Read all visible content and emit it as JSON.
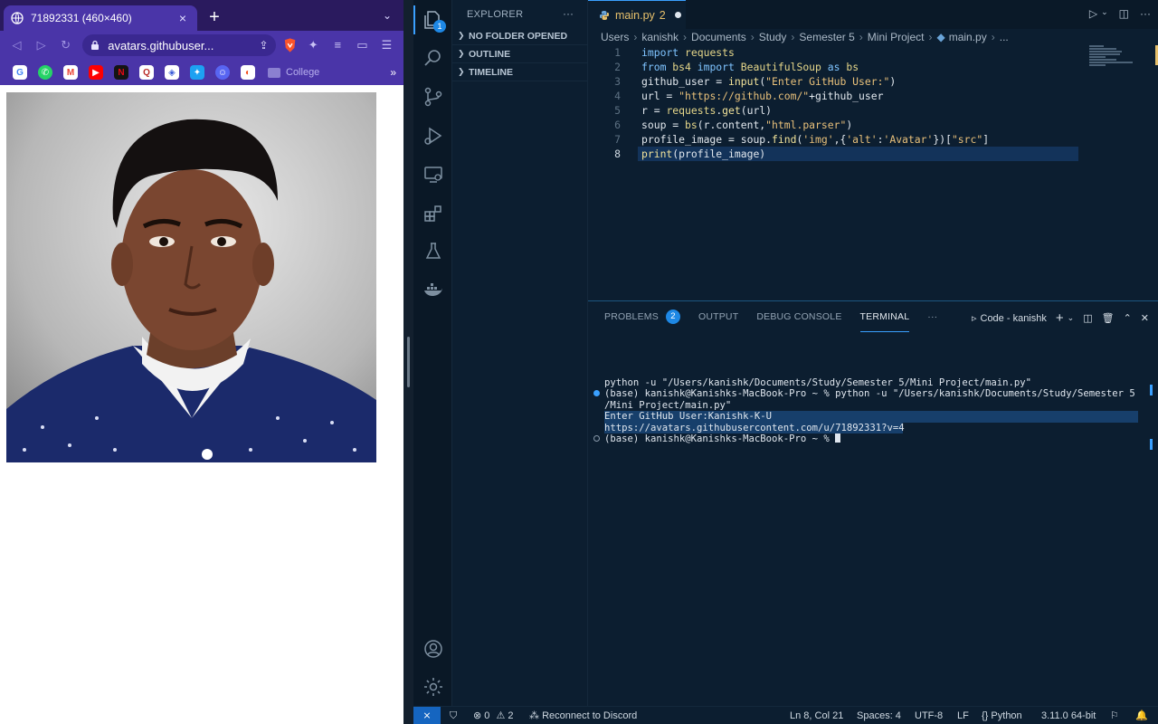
{
  "browser": {
    "tab_title": "71892331 (460×460)",
    "tab_close": "×",
    "new_tab": "+",
    "tab_menu": "⌄",
    "url": "avatars.githubuser...",
    "bookmark_folder": "College",
    "bookmarks_more": "»",
    "bookmark_icons": [
      "google-icon",
      "whatsapp-icon",
      "gmail-icon",
      "youtube-icon",
      "netflix-icon",
      "quora-icon",
      "app-icon",
      "twitter-icon",
      "discord-icon",
      "figma-icon"
    ]
  },
  "vscode": {
    "explorer_title": "EXPLORER",
    "explorer_more": "···",
    "sections": [
      "NO FOLDER OPENED",
      "OUTLINE",
      "TIMELINE"
    ],
    "activity_badge": "1",
    "editor_tab": {
      "name": "main.py",
      "problems": "2"
    },
    "breadcrumb": [
      "Users",
      "kanishk",
      "Documents",
      "Study",
      "Semester 5",
      "Mini Project",
      "main.py",
      "..."
    ],
    "code_lines": [
      {
        "n": "1",
        "text": "import requests"
      },
      {
        "n": "2",
        "text": "from bs4 import BeautifulSoup as bs"
      },
      {
        "n": "3",
        "text": "github_user = input(\"Enter GitHub User:\")"
      },
      {
        "n": "4",
        "text": "url = \"https://github.com/\"+github_user"
      },
      {
        "n": "5",
        "text": "r = requests.get(url)"
      },
      {
        "n": "6",
        "text": "soup = bs(r.content,\"html.parser\")"
      },
      {
        "n": "7",
        "text": "profile_image = soup.find('img',{'alt':'Avatar'})[\"src\"]"
      },
      {
        "n": "8",
        "text": "print(profile_image)"
      }
    ],
    "panel_tabs": [
      "PROBLEMS",
      "OUTPUT",
      "DEBUG CONSOLE",
      "TERMINAL"
    ],
    "problems_count": "2",
    "panel_more": "···",
    "terminal_name": "Code - kanishk",
    "terminal_lines": [
      "python -u \"/Users/kanishk/Documents/Study/Semester 5/Mini Project/main.py\"",
      "(base) kanishk@Kanishks-MacBook-Pro ~ % python -u \"/Users/kanishk/Documents/Study/Semester 5",
      "/Mini Project/main.py\"",
      "Enter GitHub User:Kanishk-K-U",
      "https://avatars.githubusercontent.com/u/71892331?v=4",
      "(base) kanishk@Kanishks-MacBook-Pro ~ % "
    ],
    "status": {
      "errors": "0",
      "warnings": "2",
      "discord": "Reconnect to Discord",
      "position": "Ln 8, Col 21",
      "spaces": "Spaces: 4",
      "encoding": "UTF-8",
      "eol": "LF",
      "language": "Python",
      "interpreter": "3.11.0 64-bit"
    }
  }
}
